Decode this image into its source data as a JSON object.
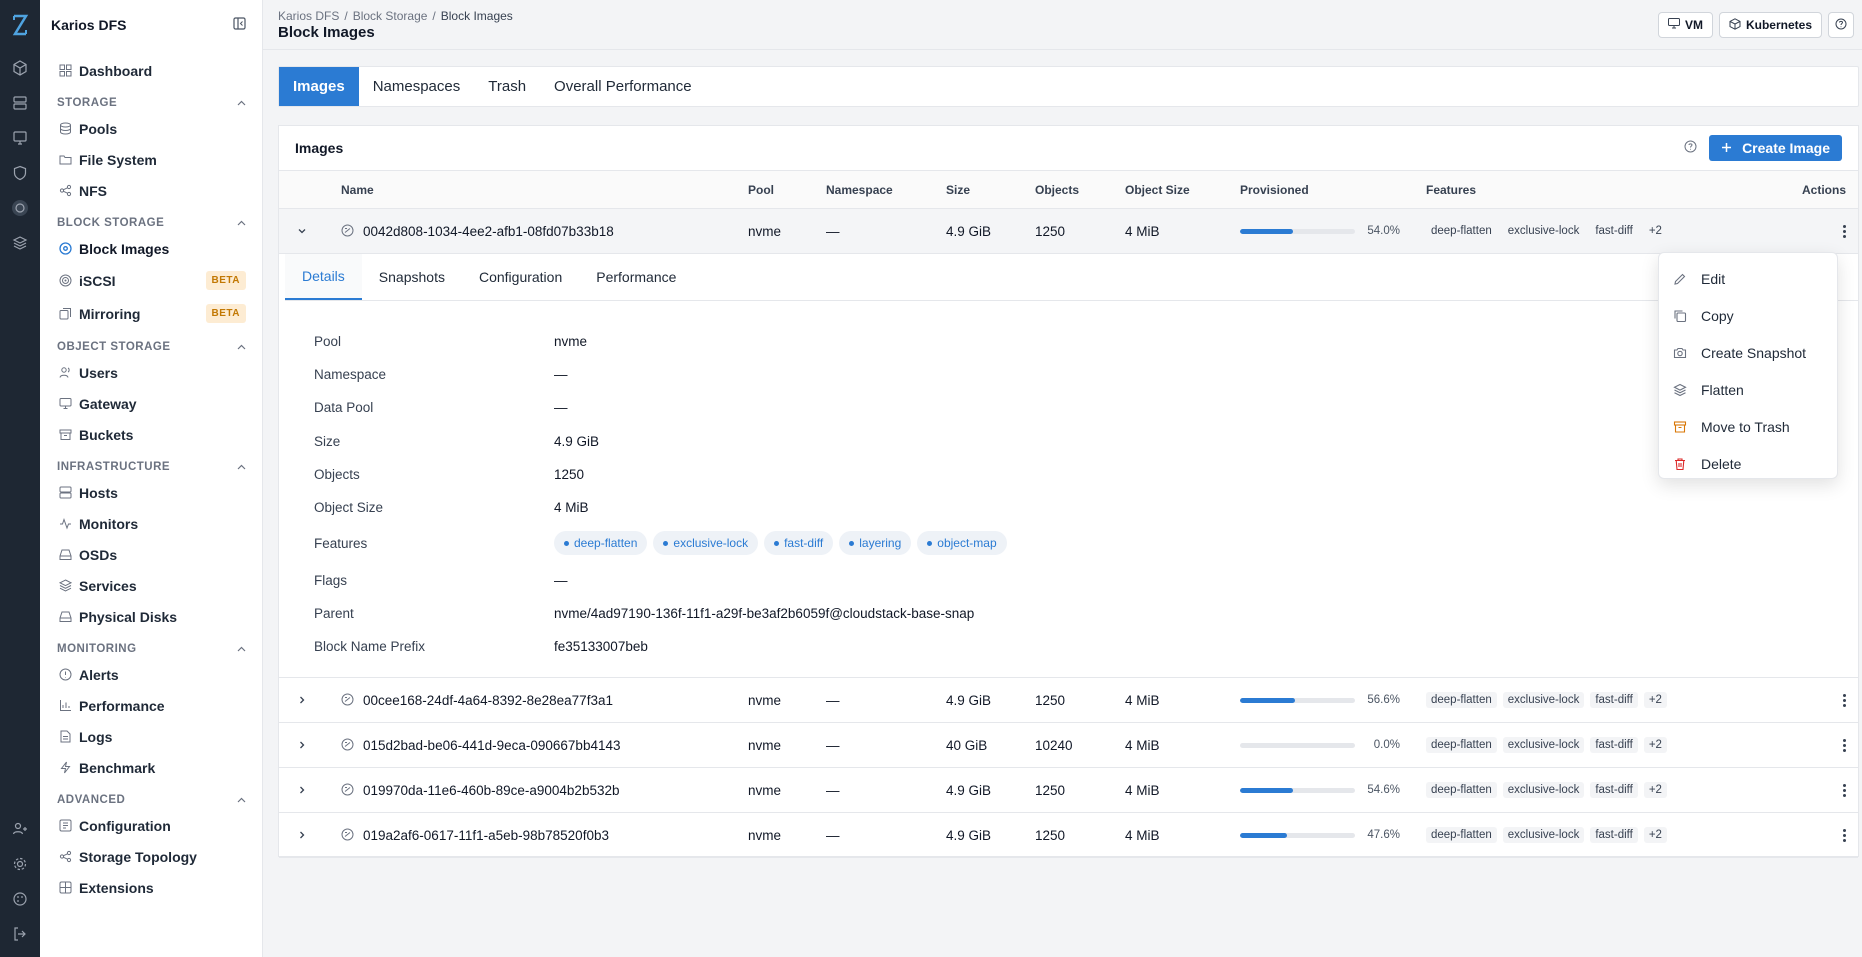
{
  "app": {
    "name": "Karios DFS"
  },
  "sidebar": {
    "dashboard": "Dashboard",
    "sections": {
      "storage": "STORAGE",
      "block_storage": "BLOCK STORAGE",
      "object_storage": "OBJECT STORAGE",
      "infrastructure": "INFRASTRUCTURE",
      "monitoring": "MONITORING",
      "advanced": "ADVANCED"
    },
    "items": {
      "pools": "Pools",
      "file_system": "File System",
      "nfs": "NFS",
      "block_images": "Block Images",
      "iscsi": "iSCSI",
      "mirroring": "Mirroring",
      "users": "Users",
      "gateway": "Gateway",
      "buckets": "Buckets",
      "hosts": "Hosts",
      "monitors": "Monitors",
      "osds": "OSDs",
      "services": "Services",
      "physical_disks": "Physical Disks",
      "alerts": "Alerts",
      "performance": "Performance",
      "logs": "Logs",
      "benchmark": "Benchmark",
      "configuration": "Configuration",
      "storage_topology": "Storage Topology",
      "extensions": "Extensions"
    },
    "beta_label": "BETA"
  },
  "header": {
    "breadcrumb": [
      "Karios DFS",
      "Block Storage",
      "Block Images"
    ],
    "separator": "/",
    "title": "Block Images",
    "vm_label": "VM",
    "kubernetes_label": "Kubernetes"
  },
  "tabs": [
    "Images",
    "Namespaces",
    "Trash",
    "Overall Performance"
  ],
  "images_card": {
    "title": "Images",
    "create_label": "Create Image",
    "columns": {
      "name": "Name",
      "pool": "Pool",
      "namespace": "Namespace",
      "size": "Size",
      "objects": "Objects",
      "object_size": "Object Size",
      "provisioned": "Provisioned",
      "features": "Features",
      "actions": "Actions"
    },
    "rows": [
      {
        "name": "0042d808-1034-4ee2-afb1-08fd07b33b18",
        "pool": "nvme",
        "namespace": "—",
        "size": "4.9 GiB",
        "objects": "1250",
        "object_size": "4 MiB",
        "provisioned_pct": 54.0,
        "provisioned_label": "54.0%",
        "features": [
          "deep-flatten",
          "exclusive-lock",
          "fast-diff"
        ],
        "more": "+2"
      },
      {
        "name": "00cee168-24df-4a64-8392-8e28ea77f3a1",
        "pool": "nvme",
        "namespace": "—",
        "size": "4.9 GiB",
        "objects": "1250",
        "object_size": "4 MiB",
        "provisioned_pct": 56.6,
        "provisioned_label": "56.6%",
        "features": [
          "deep-flatten",
          "exclusive-lock",
          "fast-diff"
        ],
        "more": "+2"
      },
      {
        "name": "015d2bad-be06-441d-9eca-090667bb4143",
        "pool": "nvme",
        "namespace": "—",
        "size": "40 GiB",
        "objects": "10240",
        "object_size": "4 MiB",
        "provisioned_pct": 0.0,
        "provisioned_label": "0.0%",
        "features": [
          "deep-flatten",
          "exclusive-lock",
          "fast-diff"
        ],
        "more": "+2"
      },
      {
        "name": "019970da-11e6-460b-89ce-a9004b2b532b",
        "pool": "nvme",
        "namespace": "—",
        "size": "4.9 GiB",
        "objects": "1250",
        "object_size": "4 MiB",
        "provisioned_pct": 54.6,
        "provisioned_label": "54.6%",
        "features": [
          "deep-flatten",
          "exclusive-lock",
          "fast-diff"
        ],
        "more": "+2"
      },
      {
        "name": "019a2af6-0617-11f1-a5eb-98b78520f0b3",
        "pool": "nvme",
        "namespace": "—",
        "size": "4.9 GiB",
        "objects": "1250",
        "object_size": "4 MiB",
        "provisioned_pct": 47.6,
        "provisioned_label": "47.6%",
        "features": [
          "deep-flatten",
          "exclusive-lock",
          "fast-diff"
        ],
        "more": "+2"
      }
    ]
  },
  "detail": {
    "tabs": [
      "Details",
      "Snapshots",
      "Configuration",
      "Performance"
    ],
    "fields": [
      {
        "label": "Pool",
        "value": "nvme"
      },
      {
        "label": "Namespace",
        "value": "—"
      },
      {
        "label": "Data Pool",
        "value": "—"
      },
      {
        "label": "Size",
        "value": "4.9 GiB"
      },
      {
        "label": "Objects",
        "value": "1250"
      },
      {
        "label": "Object Size",
        "value": "4 MiB"
      },
      {
        "label": "Features",
        "value": ""
      },
      {
        "label": "Flags",
        "value": "—"
      },
      {
        "label": "Parent",
        "value": "nvme/4ad97190-136f-11f1-a29f-be3af2b6059f@cloudstack-base-snap"
      },
      {
        "label": "Block Name Prefix",
        "value": "fe35133007beb"
      }
    ],
    "feature_chips": [
      "deep-flatten",
      "exclusive-lock",
      "fast-diff",
      "layering",
      "object-map"
    ]
  },
  "actions_menu": {
    "items": [
      {
        "label": "Edit",
        "icon": "pencil-icon"
      },
      {
        "label": "Copy",
        "icon": "copy-icon"
      },
      {
        "label": "Create Snapshot",
        "icon": "camera-icon"
      },
      {
        "label": "Flatten",
        "icon": "layers-icon"
      },
      {
        "label": "Move to Trash",
        "icon": "archive-icon"
      },
      {
        "label": "Delete",
        "icon": "trash-icon"
      }
    ]
  },
  "colors": {
    "accent": "#2b7bd3",
    "rail": "#1e2733",
    "beta_bg": "#fdecd3",
    "beta_text": "#c27803",
    "delete": "#dc2626",
    "trash": "#d97706"
  }
}
